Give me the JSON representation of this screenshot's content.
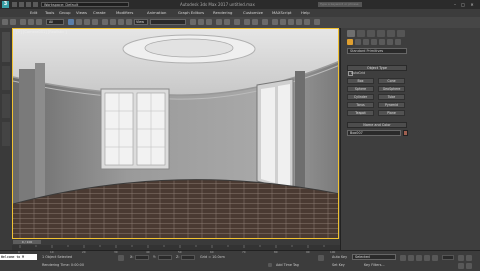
{
  "titlebar": {
    "workspace": "Workspace: Default",
    "window_title": "Autodesk 3ds Max 2017  untitled.max",
    "search_placeholder": "Type a keyword or phrase"
  },
  "menubar": {
    "items": [
      "Edit",
      "Tools",
      "Group",
      "Views",
      "Create",
      "Modifiers",
      "Animation",
      "Graph Editors",
      "Rendering",
      "Customize",
      "MAXScript",
      "Help"
    ]
  },
  "toolbar": {
    "selection_filter": "All",
    "reference_coord": "View"
  },
  "viewport": {
    "label": "[+] [Camera001] [Realistic ]",
    "accent": "#f1c232"
  },
  "command_panel": {
    "category": "Standard Primitives",
    "object_type_title": "Object Type",
    "autogrid_label": "AutoGrid",
    "object_buttons": [
      "Box",
      "Cone",
      "Sphere",
      "GeoSphere",
      "Cylinder",
      "Tube",
      "Torus",
      "Pyramid",
      "Teapot",
      "Plane"
    ],
    "name_color_title": "Name and Color",
    "name_value": "Box007"
  },
  "timeline": {
    "slider": "0 / 100",
    "ticks": [
      "0",
      "5",
      "10",
      "15",
      "20",
      "25",
      "30",
      "35",
      "40",
      "45",
      "50",
      "55",
      "60",
      "65",
      "70",
      "75",
      "80",
      "85",
      "90",
      "95",
      "100"
    ]
  },
  "statusbar": {
    "script_text": "Welcome to M",
    "selected": "1 Object Selected",
    "rendering_time": "Rendering Time: 0:00:00",
    "x_label": "X:",
    "y_label": "Y:",
    "z_label": "Z:",
    "grid": "Grid = 10.0cm",
    "autokey": "Auto Key",
    "setkey": "Set Key",
    "selected_dropdown": "Selected",
    "key_filters": "Key Filters...",
    "add_time_tag": "Add Time Tag"
  }
}
